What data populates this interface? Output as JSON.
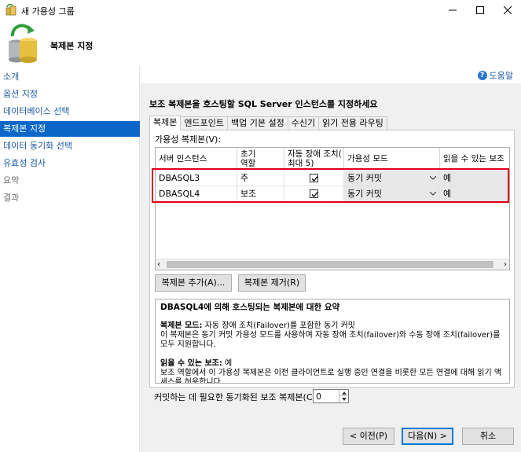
{
  "window": {
    "title": "새 가용성 그룹"
  },
  "header": {
    "title": "복제본 지정"
  },
  "sidebar": {
    "items": [
      {
        "label": "소개",
        "state": "link"
      },
      {
        "label": "옵션 지정",
        "state": "link"
      },
      {
        "label": "데이터베이스 선택",
        "state": "link"
      },
      {
        "label": "복제본 지정",
        "state": "active"
      },
      {
        "label": "데이터 동기화 선택",
        "state": "link"
      },
      {
        "label": "유효성 검사",
        "state": "link"
      },
      {
        "label": "요약",
        "state": "disabled"
      },
      {
        "label": "결과",
        "state": "disabled"
      }
    ]
  },
  "help": {
    "label": "도움말"
  },
  "instruction": "보조 복제본을 호스팅할 SQL Server 인스턴스를 지정하세요",
  "tabs": [
    {
      "label": "복제본",
      "active": true
    },
    {
      "label": "엔드포인트",
      "active": false
    },
    {
      "label": "백업 기본 설정",
      "active": false
    },
    {
      "label": "수신기",
      "active": false
    },
    {
      "label": "읽기 전용 라우팅",
      "active": false
    }
  ],
  "replicas": {
    "group_label": "가용성 복제본(V):",
    "columns": [
      "서버 인스턴스",
      "초기\n역할",
      "자동 장애 조치(\n최대 5)",
      "가용성 모드",
      "읽을 수 있는 보조"
    ],
    "rows": [
      {
        "server": "DBASQL3",
        "role": "주",
        "auto_failover": true,
        "mode": "동기 커밋",
        "readable": "예"
      },
      {
        "server": "DBASQL4",
        "role": "보조",
        "auto_failover": true,
        "mode": "동기 커밋",
        "readable": "예"
      }
    ]
  },
  "buttons": {
    "add_replica": "복제본 추가(A)...",
    "remove_replica": "복제본 제거(R)",
    "prev": "< 이전(P)",
    "next": "다음(N) >",
    "cancel": "취소"
  },
  "summary": {
    "title": "DBASQL4에 의해 호스팅되는 복제본에 대한 요약",
    "mode_label": "복제본 모드:",
    "mode_value": " 자동 장애 조치(Failover)를 포함한 동기 커밋",
    "mode_desc": "이 복제본은 동기 커밋 가용성 모드를 사용하며 자동 장애 조치(failover)와 수동 장애 조치(failover)를 모두 지원합니다.",
    "readable_label": "읽을 수 있는 보조:",
    "readable_value": " 예",
    "readable_desc": "보조 역할에서 이 가용성 복제본은 이전 클라이언트로 실행 중인 연결을 비롯한 모든 연결에 대해 읽기 액세스를 허용합니다."
  },
  "sync": {
    "label": "커밋하는 데 필요한 동기화된 보조 복제본(C)",
    "value": "0"
  },
  "colors": {
    "accent": "#0a67c8",
    "highlight": "#e0001b",
    "link": "#1e5aa8"
  }
}
